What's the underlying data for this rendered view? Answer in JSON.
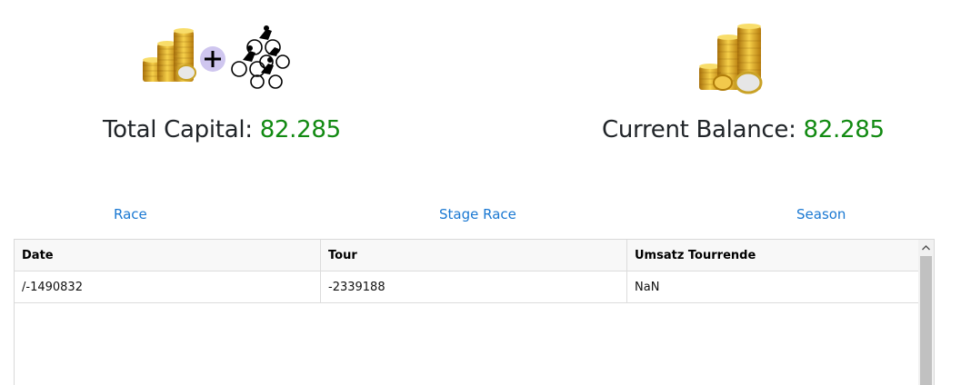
{
  "capital": {
    "label": "Total Capital:",
    "value": "82.285"
  },
  "balance": {
    "label": "Current Balance:",
    "value": "82.285"
  },
  "tabs": {
    "race": "Race",
    "stage_race": "Stage Race",
    "season": "Season"
  },
  "table": {
    "headers": [
      "Date",
      "Tour",
      "Umsatz Tourrende"
    ],
    "rows": [
      [
        "/-1490832",
        "-2339188",
        "NaN"
      ]
    ]
  },
  "icons": {
    "capital_icon": "coins-plus-cyclists-icon",
    "balance_icon": "coins-icon"
  },
  "colors": {
    "value": "#128a12",
    "link": "#1a78d2"
  }
}
